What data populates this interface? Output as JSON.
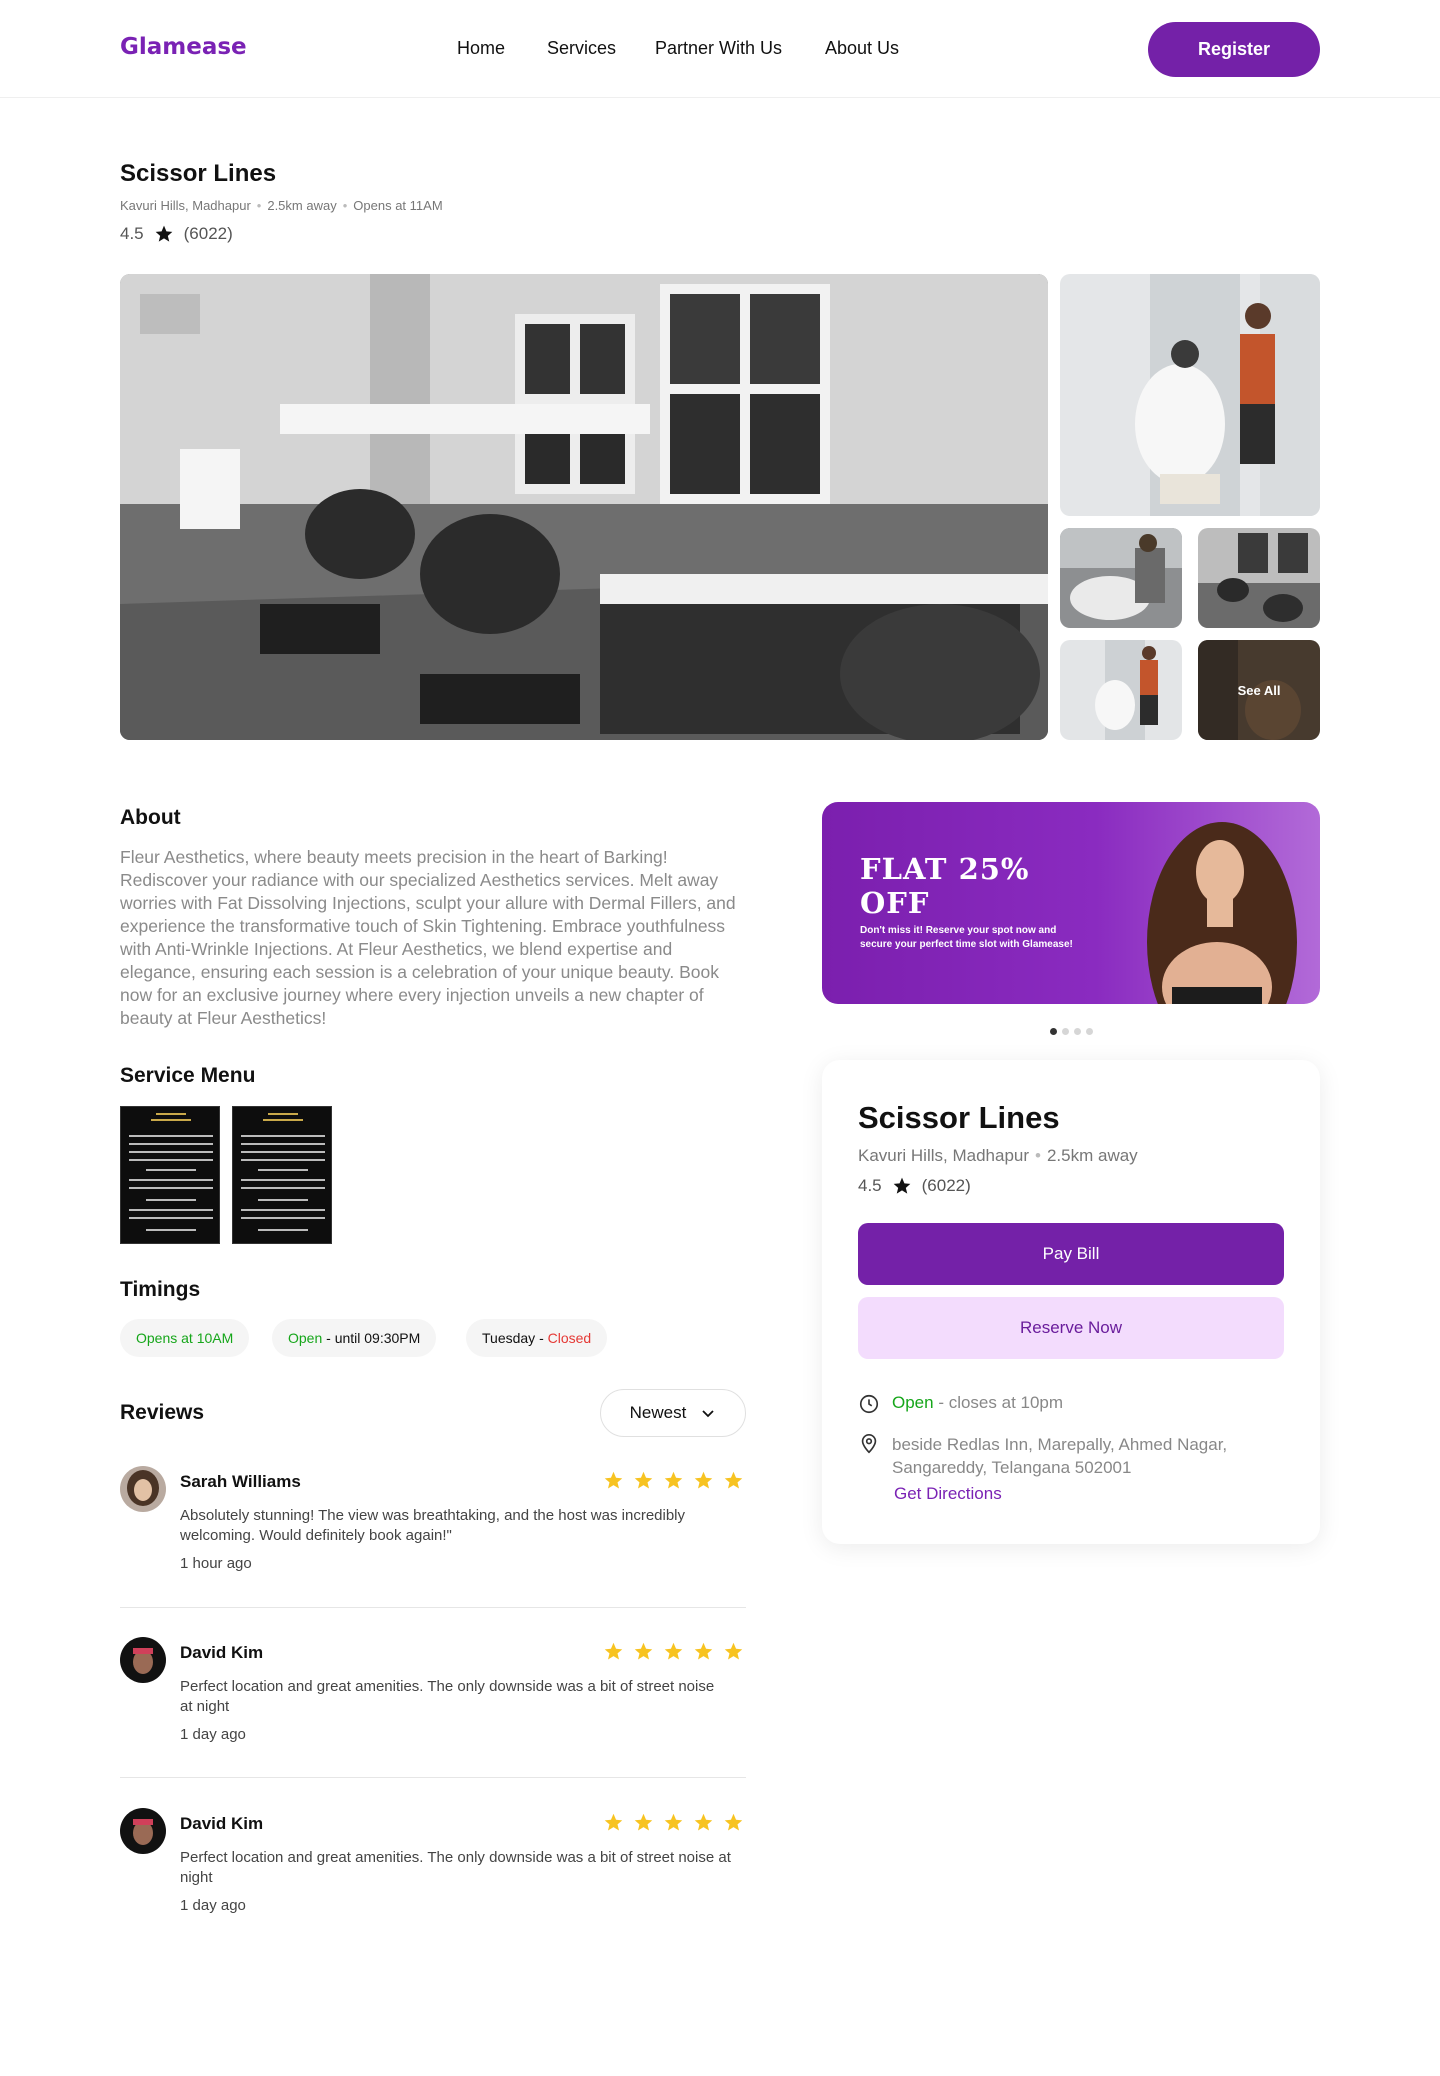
{
  "header": {
    "logo": "Glamease",
    "nav": [
      "Home",
      "Services",
      "Partner With Us",
      "About Us"
    ],
    "register_label": "Register"
  },
  "salon": {
    "name": "Scissor Lines",
    "area": "Kavuri Hills, Madhapur",
    "distance": "2.5km away",
    "opens": "Opens at 11AM",
    "rating": "4.5",
    "reviews_count": "(6022)"
  },
  "gallery": {
    "see_all": "See All"
  },
  "about": {
    "heading": "About",
    "text": "Fleur Aesthetics, where beauty meets precision in the heart of Barking! Rediscover your radiance with our specialized Aesthetics services. Melt away worries with Fat Dissolving Injections, sculpt your allure with Dermal Fillers, and experience the transformative touch of Skin Tightening. Embrace youthfulness with Anti-Wrinkle Injections. At Fleur Aesthetics, we blend expertise and elegance, ensuring each session is a celebration of your unique beauty. Book now for an exclusive journey where every injection unveils a new chapter of beauty at Fleur Aesthetics!"
  },
  "service_menu": {
    "heading": "Service Menu"
  },
  "timings": {
    "heading": "Timings",
    "chip1": "Opens at 10AM",
    "chip2_status": "Open",
    "chip2_rest": " - until 09:30PM",
    "chip3_day": "Tuesday",
    "chip3_sep": " - ",
    "chip3_status": "Closed"
  },
  "reviews": {
    "heading": "Reviews",
    "sort_label": "Newest",
    "items": [
      {
        "name": "Sarah Williams",
        "text": "Absolutely stunning! The view was breathtaking, and the host was incredibly welcoming. Would definitely book again!\"",
        "time": "1 hour ago",
        "stars": 5
      },
      {
        "name": "David Kim",
        "text": "Perfect location and great amenities. The only downside was a bit of street noise at night",
        "time": "1 day ago",
        "stars": 5
      },
      {
        "name": "David Kim",
        "text": "Perfect location and great amenities. The only downside was a bit of street noise at night",
        "time": "1 day ago",
        "stars": 5
      }
    ]
  },
  "promo": {
    "line1": "FLAT 25%",
    "line2": "OFF",
    "text": "Don't miss it! Reserve your spot now and secure your perfect time slot with Glamease!"
  },
  "card": {
    "name": "Scissor Lines",
    "area": "Kavuri Hills, Madhapur",
    "distance": "2.5km away",
    "rating": "4.5",
    "reviews_count": "(6022)",
    "pay_label": "Pay Bill",
    "reserve_label": "Reserve Now",
    "open_status": "Open",
    "closes": " - closes at 10pm",
    "address": "beside Redlas Inn, Marepally, Ahmed Nagar, Sangareddy, Telangana 502001",
    "directions_label": "Get Directions"
  },
  "colors": {
    "brand": "#7421a8",
    "brand_light": "#f3dcfd",
    "open_green": "#16a61a",
    "closed_red": "#e53935",
    "star_yellow": "#f7c321"
  }
}
